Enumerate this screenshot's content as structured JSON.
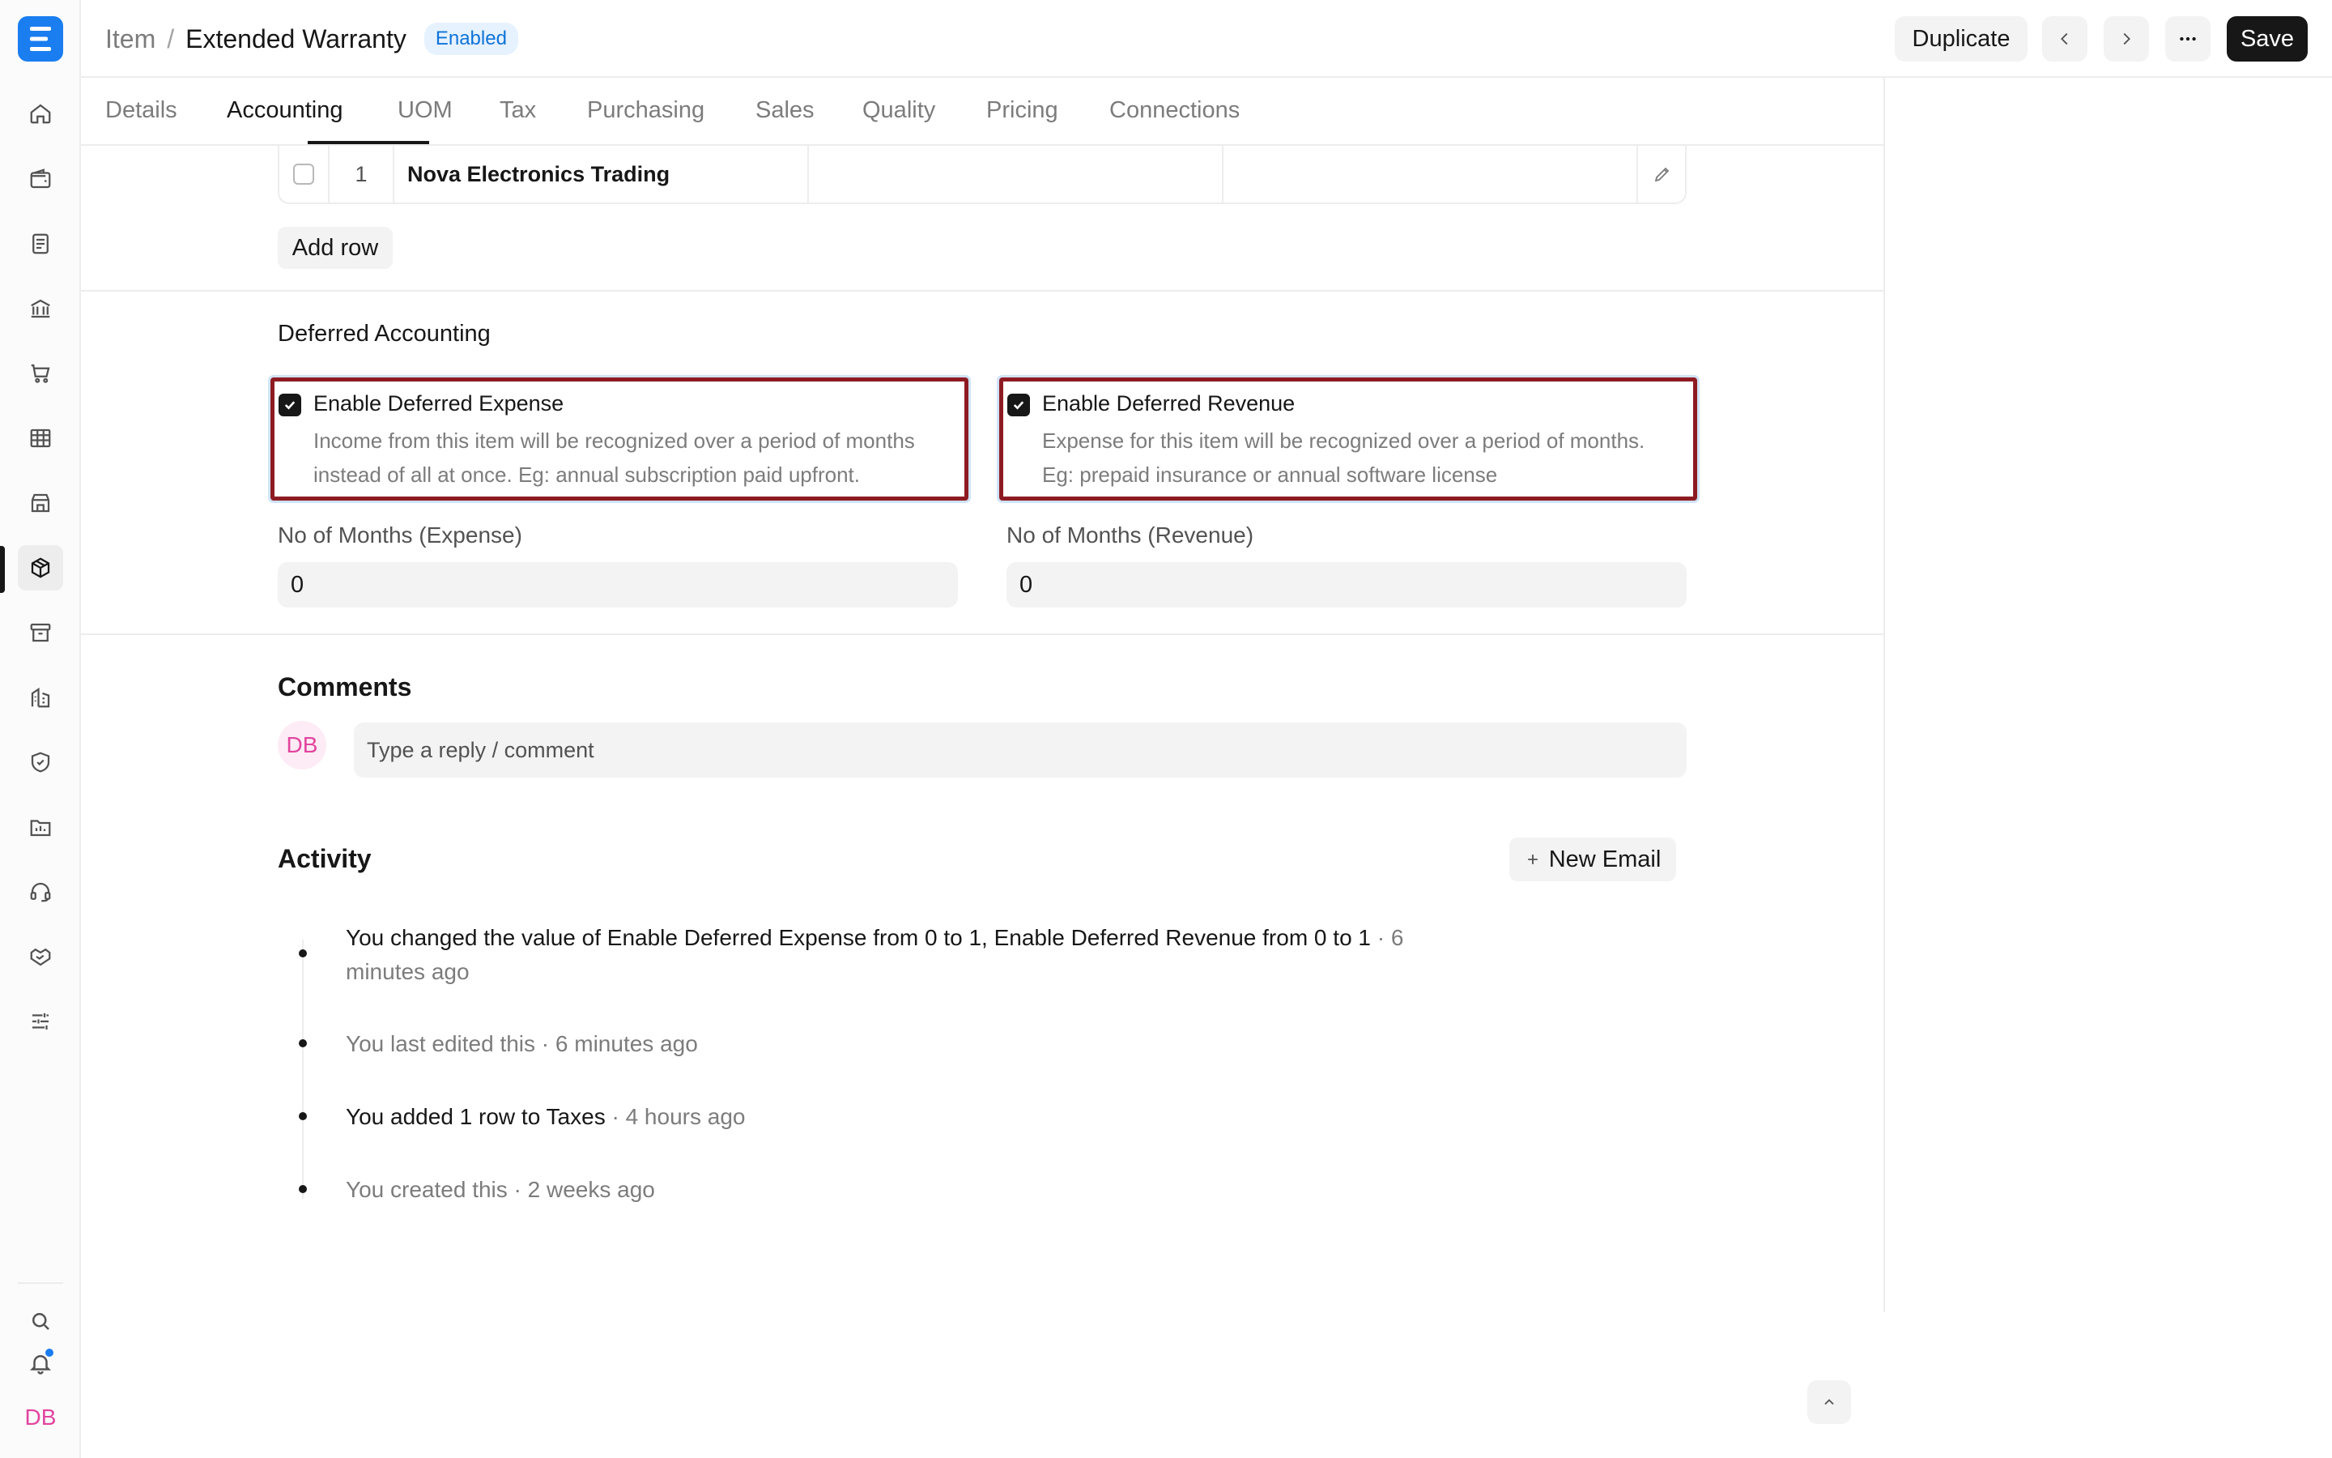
{
  "app": {
    "logo_letter": "E"
  },
  "header": {
    "breadcrumb_parent": "Item",
    "breadcrumb_separator": "/",
    "title": "Extended Warranty",
    "status": "Enabled",
    "duplicate_label": "Duplicate",
    "save_label": "Save"
  },
  "sidebar": {
    "icons": [
      "home-icon",
      "wallet-icon",
      "document-icon",
      "bank-icon",
      "cart-icon",
      "table-icon",
      "store-icon",
      "package-icon",
      "archive-icon",
      "building-icon",
      "shield-icon",
      "folder-chart-icon",
      "headset-icon",
      "handshake-icon",
      "sliders-icon"
    ],
    "active": "package-icon",
    "user_initials": "DB"
  },
  "tabs": [
    "Details",
    "Accounting",
    "UOM",
    "Tax",
    "Purchasing",
    "Sales",
    "Quality",
    "Pricing",
    "Connections"
  ],
  "active_tab": "Accounting",
  "grid": {
    "row_number": "1",
    "row_name": "Nova Electronics Trading",
    "add_row_label": "Add row"
  },
  "deferred": {
    "section_title": "Deferred Accounting",
    "expense": {
      "label": "Enable Deferred Expense",
      "checked": true,
      "desc_line1": "Income from this item will be recognized over a period of months",
      "desc_line2": "instead of all at once. Eg: annual subscription paid upfront."
    },
    "revenue": {
      "label": "Enable Deferred Revenue",
      "checked": true,
      "desc_line1": "Expense for this item will be recognized over a period of months.",
      "desc_line2": "Eg: prepaid insurance or annual software license"
    },
    "months_expense_label": "No of Months (Expense)",
    "months_expense_value": "0",
    "months_revenue_label": "No of Months (Revenue)",
    "months_revenue_value": "0"
  },
  "comments": {
    "title": "Comments",
    "avatar": "DB",
    "placeholder": "Type a reply / comment"
  },
  "activity": {
    "title": "Activity",
    "new_email_label": "New Email",
    "items": [
      {
        "line1_strong": "You changed the value of Enable Deferred Expense from 0 to 1, Enable Deferred Revenue from 0 to 1",
        "line1_muted": " · 6",
        "line2_muted": "minutes ago"
      },
      {
        "strong": "",
        "muted": "You last edited this · 6 minutes ago"
      },
      {
        "strong": "You added 1 row to Taxes",
        "muted": " · 4 hours ago"
      },
      {
        "strong": "",
        "muted": "You created this · 2 weeks ago"
      }
    ]
  },
  "colors": {
    "accent": "#1a7df0",
    "highlight_border": "#8e1b22",
    "avatar_pink": "#e2449f"
  }
}
